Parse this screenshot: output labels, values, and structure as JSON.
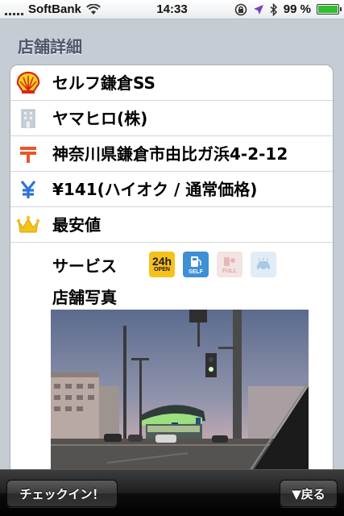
{
  "status_bar": {
    "carrier": "SoftBank",
    "time": "14:33",
    "battery": "99 %",
    "battery_level": 0.99
  },
  "section_title": "店舗詳細",
  "rows": [
    {
      "icon": "shell-logo-icon",
      "text": "セルフ鎌倉SS"
    },
    {
      "icon": "building-icon",
      "text": "ヤマヒロ(株)"
    },
    {
      "icon": "postal-mark-icon",
      "text": "神奈川県鎌倉市由比ガ浜4-2-12"
    },
    {
      "icon": "yen-icon",
      "text": "¥141(ハイオク / 通常価格)"
    },
    {
      "icon": "crown-icon",
      "text": "最安値"
    }
  ],
  "services": {
    "label": "サービス",
    "items": [
      {
        "name": "24h-open-icon",
        "big": "24h",
        "small": "OPEN",
        "active": true
      },
      {
        "name": "self-service-icon",
        "small": "SELF",
        "active": true
      },
      {
        "name": "full-service-icon",
        "small": "FULL",
        "active": false
      },
      {
        "name": "car-wash-icon",
        "active": false
      }
    ]
  },
  "photo_label": "店舗写真",
  "toolbar": {
    "checkin_label": "チェックイン！",
    "back_label": "▼戻る"
  }
}
